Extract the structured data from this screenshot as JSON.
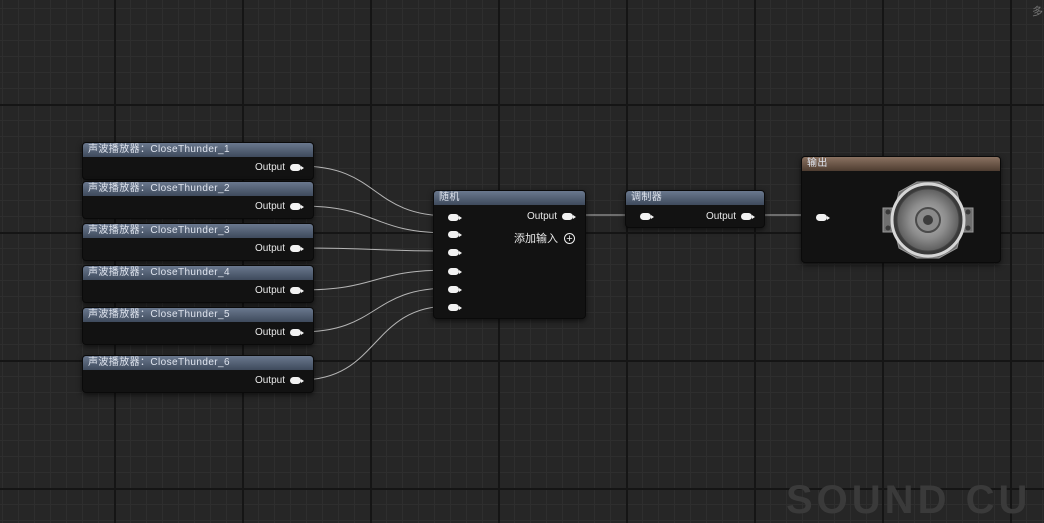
{
  "corner_tag": "多",
  "watermark": "SOUND CU",
  "players": [
    {
      "title": "声波播放器：CloseThunder_1",
      "output": "Output"
    },
    {
      "title": "声波播放器：CloseThunder_2",
      "output": "Output"
    },
    {
      "title": "声波播放器：CloseThunder_3",
      "output": "Output"
    },
    {
      "title": "声波播放器：CloseThunder_4",
      "output": "Output"
    },
    {
      "title": "声波播放器：CloseThunder_5",
      "output": "Output"
    },
    {
      "title": "声波播放器：CloseThunder_6",
      "output": "Output"
    }
  ],
  "random_node": {
    "title": "随机",
    "output": "Output",
    "add_input": "添加输入"
  },
  "modulator_node": {
    "title": "调制器",
    "output": "Output"
  },
  "output_node": {
    "title": "输出"
  },
  "colors": {
    "header_blue": "#5a6880",
    "header_brown": "#7a6252",
    "pin": "#f2f2f2",
    "wire": "#cfcfcf"
  }
}
